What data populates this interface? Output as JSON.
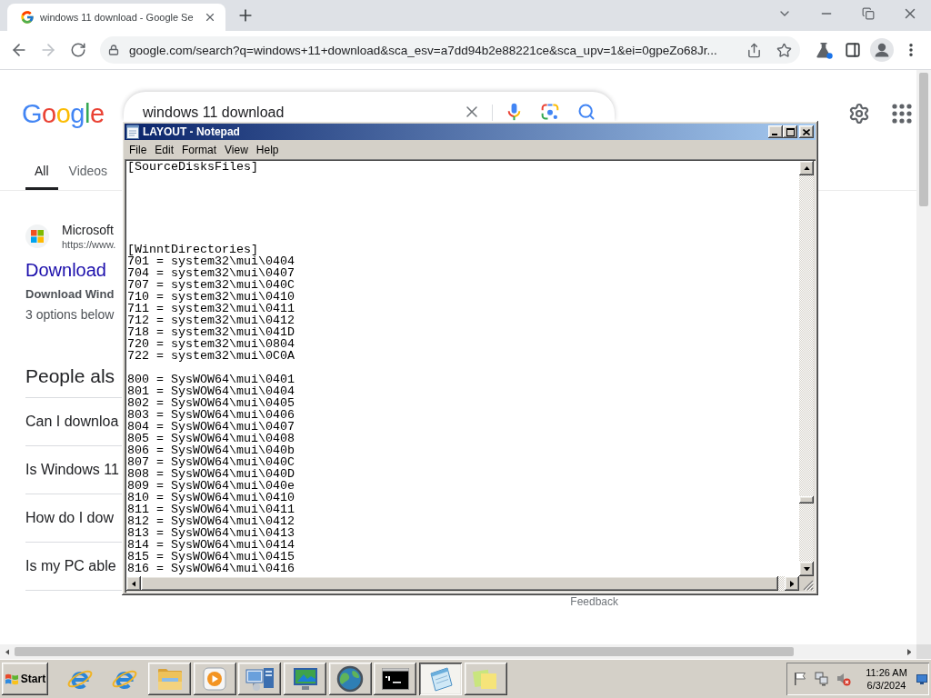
{
  "browser": {
    "tabs": [
      {
        "title": "windows 11 download - Google Se",
        "selected": true
      }
    ],
    "back_disabled": false,
    "forward_disabled": true,
    "address": "google.com/search?q=windows+11+download&sca_esv=a7dd94b2e88221ce&sca_upv=1&ei=0gpeZo68Jr..."
  },
  "google": {
    "logo": "Google",
    "query": "windows 11 download",
    "tabs": [
      {
        "label": "All",
        "selected": true
      },
      {
        "label": "Videos",
        "selected": false
      }
    ],
    "result": {
      "site": "Microsoft",
      "url": "https://www.",
      "title": "Download",
      "subtitle": "Download Wind",
      "snippet": "3 options below"
    },
    "people_also_ask": {
      "heading": "People als",
      "questions": [
        "Can I downloa",
        "Is Windows 11",
        "How do I dow",
        "Is my PC able"
      ]
    },
    "feedback": "Feedback"
  },
  "notepad": {
    "title": "LAYOUT - Notepad",
    "active": true,
    "menu": [
      "File",
      "Edit",
      "Format",
      "View",
      "Help"
    ],
    "content": "[SourceDisksFiles]\n\n\n\n\n\n\n[WinntDirectories]\n701 = system32\\mui\\0404\n704 = system32\\mui\\0407\n707 = system32\\mui\\040C\n710 = system32\\mui\\0410\n711 = system32\\mui\\0411\n712 = system32\\mui\\0412\n718 = system32\\mui\\041D\n720 = system32\\mui\\0804\n722 = system32\\mui\\0C0A\n\n800 = SysWOW64\\mui\\0401\n801 = SysWOW64\\mui\\0404\n802 = SysWOW64\\mui\\0405\n803 = SysWOW64\\mui\\0406\n804 = SysWOW64\\mui\\0407\n805 = SysWOW64\\mui\\0408\n806 = SysWOW64\\mui\\040b\n807 = SysWOW64\\mui\\040C\n808 = SysWOW64\\mui\\040D\n809 = SysWOW64\\mui\\040e\n810 = SysWOW64\\mui\\0410\n811 = SysWOW64\\mui\\0411\n812 = SysWOW64\\mui\\0412\n813 = SysWOW64\\mui\\0413\n814 = SysWOW64\\mui\\0414\n815 = SysWOW64\\mui\\0415\n816 = SysWOW64\\mui\\0416"
  },
  "taskbar": {
    "start": "Start",
    "windows": [
      {
        "selected": false
      },
      {
        "selected": false
      },
      {
        "selected": false
      },
      {
        "selected": false
      },
      {
        "selected": false
      },
      {
        "selected": false
      },
      {
        "selected": true
      },
      {
        "selected": false
      }
    ],
    "clock": {
      "time": "11:26 AM",
      "date": "6/3/2024"
    }
  }
}
